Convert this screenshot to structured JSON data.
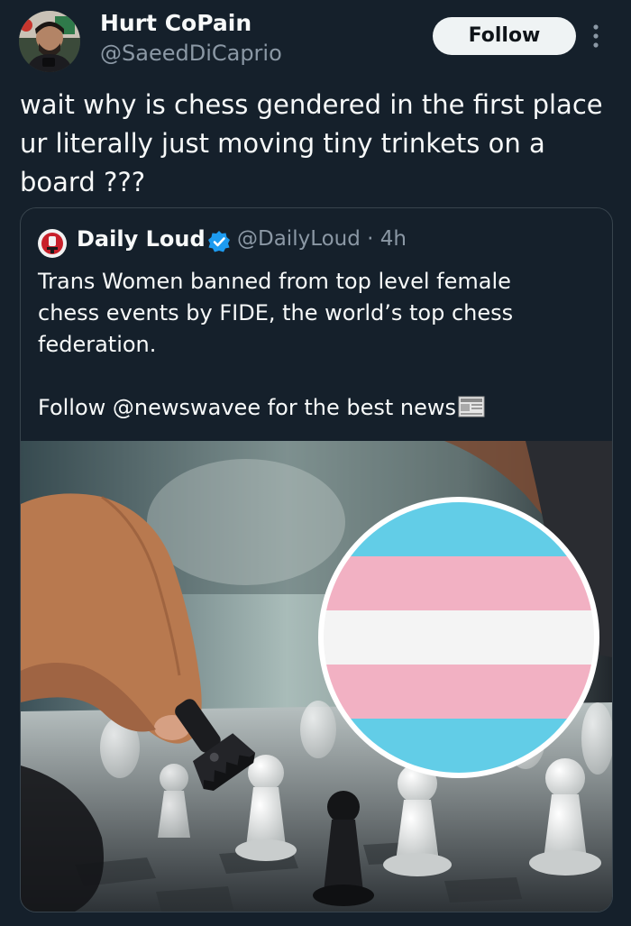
{
  "author": {
    "display_name": "Hurt CoPain",
    "handle": "@SaeedDiCaprio",
    "avatar_icon": "profile-photo"
  },
  "actions": {
    "follow_label": "Follow",
    "more_icon": "more-vertical-icon"
  },
  "tweet": {
    "lines": [
      "wait why is chess gendered in the first place",
      "ur literally just moving tiny trinkets on a",
      "board ???"
    ]
  },
  "quoted": {
    "display_name": "Daily Loud",
    "verified": true,
    "handle_time": "@DailyLoud · 4h",
    "lines": [
      "Trans Women banned from top level female",
      "chess events by FIDE, the world’s top chess",
      "federation."
    ],
    "follow_line": "Follow @newswavee for the best news",
    "follow_emoji": "newspaper-icon",
    "media_description": "photo"
  },
  "colors": {
    "background": "#15202b",
    "text": "#f7f9f9",
    "secondary": "#8b98a5",
    "border": "#38444d",
    "verified": "#1d9bf0",
    "flag_blue": "#62cde7",
    "flag_pink": "#f2b1c3",
    "flag_white": "#f4f4f4"
  }
}
